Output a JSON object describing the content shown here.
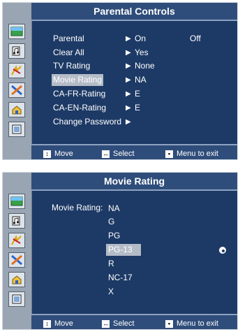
{
  "screen1": {
    "title": "Parental Controls",
    "items": [
      {
        "label": "Parental",
        "value": "On",
        "extra": "Off"
      },
      {
        "label": "Clear All",
        "value": "Yes"
      },
      {
        "label": "TV Rating",
        "value": "None"
      },
      {
        "label": "Movie Rating",
        "value": "NA"
      },
      {
        "label": "CA-FR-Rating",
        "value": "E"
      },
      {
        "label": "CA-EN-Rating",
        "value": "E"
      },
      {
        "label": "Change Password",
        "value": ""
      }
    ],
    "selected_index": 3,
    "footer": {
      "move": "Move",
      "select": "Select",
      "exit": "Menu to exit"
    }
  },
  "screen2": {
    "title": "Movie Rating",
    "label": "Movie Rating:",
    "options": [
      "NA",
      "G",
      "PG",
      "PG-13",
      "R",
      "NC-17",
      "X"
    ],
    "selected_index": 3,
    "footer": {
      "move": "Move",
      "select": "Select",
      "exit": "Menu to exit"
    }
  },
  "sidebar_icons": [
    "picture-icon",
    "sound-icon",
    "channel-icon",
    "setup-icon",
    "input-icon",
    "function-icon"
  ],
  "colors": {
    "panel": "#1d3a66",
    "header": "#2f4d7a",
    "highlight": "#b4bcc7",
    "sidebar": "#9aa5b3"
  }
}
